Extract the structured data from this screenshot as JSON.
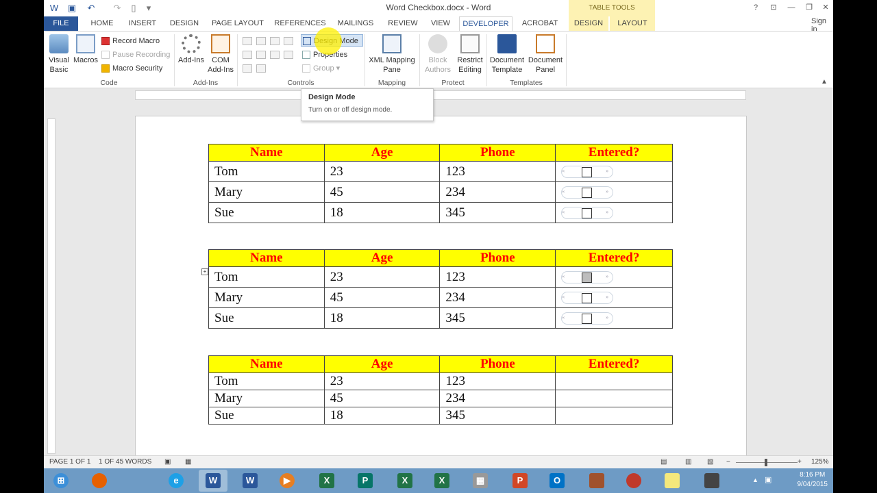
{
  "window": {
    "title": "Word Checkbox.docx - Word",
    "table_tools_label": "TABLE TOOLS",
    "sign_in": "Sign in"
  },
  "tabs": [
    {
      "label": "FILE"
    },
    {
      "label": "HOME"
    },
    {
      "label": "INSERT"
    },
    {
      "label": "DESIGN"
    },
    {
      "label": "PAGE LAYOUT"
    },
    {
      "label": "REFERENCES"
    },
    {
      "label": "MAILINGS"
    },
    {
      "label": "REVIEW"
    },
    {
      "label": "VIEW"
    },
    {
      "label": "DEVELOPER"
    },
    {
      "label": "ACROBAT"
    },
    {
      "label": "DESIGN"
    },
    {
      "label": "LAYOUT"
    }
  ],
  "ribbon": {
    "code": {
      "group_label": "Code",
      "visual_basic": "Visual Basic",
      "macros": "Macros",
      "record_macro": "Record Macro",
      "pause_recording": "Pause Recording",
      "macro_security": "Macro Security"
    },
    "addins": {
      "group_label": "Add-Ins",
      "add_ins": "Add-Ins",
      "com_add_ins": "COM Add-Ins"
    },
    "controls": {
      "group_label": "Controls",
      "design_mode": "Design Mode",
      "properties": "Properties",
      "group": "Group"
    },
    "mapping": {
      "group_label": "Mapping",
      "xml_mapping_pane": "XML Mapping Pane"
    },
    "protect": {
      "group_label": "Protect",
      "block_authors": "Block Authors",
      "restrict_editing": "Restrict Editing"
    },
    "templates": {
      "group_label": "Templates",
      "document_template": "Document Template",
      "document_panel": "Document Panel"
    }
  },
  "tooltip": {
    "title": "Design Mode",
    "text": "Turn on or off design mode."
  },
  "tables": [
    {
      "headers": [
        "Name",
        "Age",
        "Phone",
        "Entered?"
      ],
      "rows": [
        [
          "Tom",
          "23",
          "123"
        ],
        [
          "Mary",
          "45",
          "234"
        ],
        [
          "Sue",
          "18",
          "345"
        ]
      ]
    },
    {
      "headers": [
        "Name",
        "Age",
        "Phone",
        "Entered?"
      ],
      "rows": [
        [
          "Tom",
          "23",
          "123"
        ],
        [
          "Mary",
          "45",
          "234"
        ],
        [
          "Sue",
          "18",
          "345"
        ]
      ]
    },
    {
      "headers": [
        "Name",
        "Age",
        "Phone",
        "Entered?"
      ],
      "rows": [
        [
          "Tom",
          "23",
          "123"
        ],
        [
          "Mary",
          "45",
          "234"
        ],
        [
          "Sue",
          "18",
          "345"
        ]
      ]
    }
  ],
  "status": {
    "page": "PAGE 1 OF 1",
    "words": "1 OF 45 WORDS",
    "zoom": "125%"
  },
  "clock": {
    "time": "8:16 PM",
    "date": "9/04/2015"
  },
  "colors": {
    "header_bg": "#ffff00",
    "header_text": "#ff0000",
    "accent": "#2b579a"
  }
}
